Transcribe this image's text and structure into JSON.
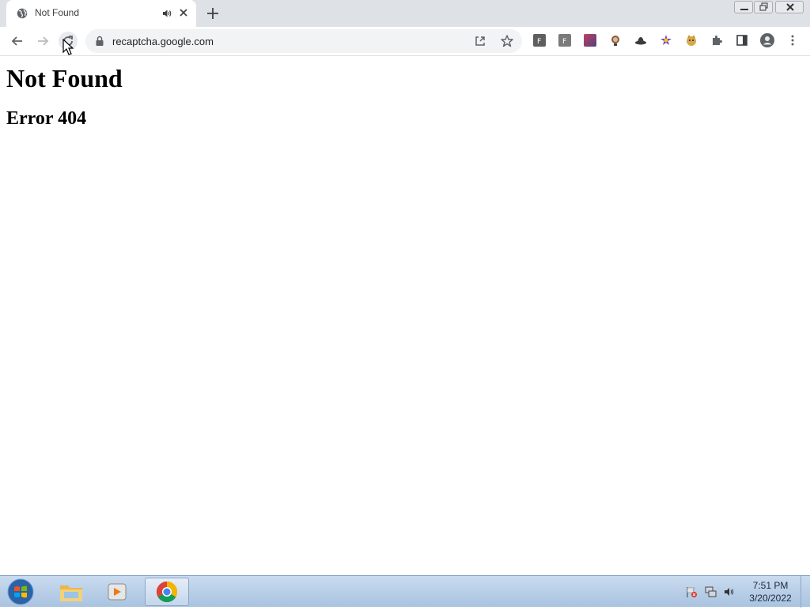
{
  "tab": {
    "title": "Not Found"
  },
  "toolbar": {
    "url": "recaptcha.google.com"
  },
  "page": {
    "heading": "Not Found",
    "subheading": "Error 404"
  },
  "taskbar": {
    "time": "7:51 PM",
    "date": "3/20/2022"
  },
  "icons": {
    "tab": [
      "globe-icon",
      "speaker-icon",
      "close-icon",
      "plus-icon"
    ],
    "toolbar": [
      "back-arrow-icon",
      "forward-arrow-icon",
      "reload-icon",
      "lock-icon",
      "share-icon",
      "star-icon",
      "extensions-puzzle-icon",
      "side-panel-icon",
      "profile-avatar-icon",
      "kebab-menu-icon"
    ],
    "taskbar": [
      "windows-start-icon",
      "file-explorer-icon",
      "media-player-icon",
      "chrome-icon",
      "flag-icon",
      "network-icon",
      "volume-icon"
    ]
  },
  "colors": {
    "accent": "#1a73e8",
    "tabstrip": "#dee1e6",
    "omnibox": "#f1f3f4",
    "taskbar": "#b4cbe6"
  }
}
